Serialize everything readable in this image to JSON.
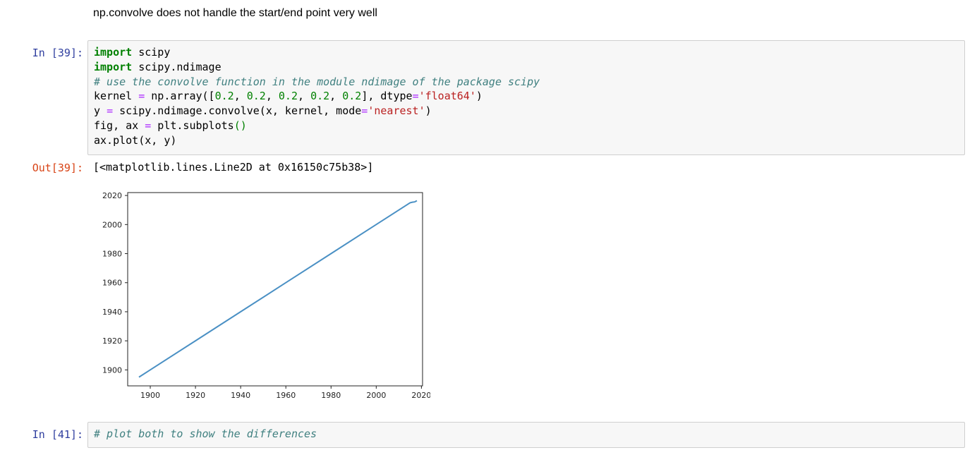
{
  "markdown": {
    "text": "np.convolve does not handle the start/end point very well"
  },
  "cell39": {
    "prompt_in": "In [39]:",
    "prompt_out": "Out[39]:",
    "lines": [
      [
        {
          "t": "import",
          "c": "kw"
        },
        {
          "t": " scipy",
          "c": ""
        }
      ],
      [
        {
          "t": "import",
          "c": "kw"
        },
        {
          "t": " scipy.ndimage",
          "c": ""
        }
      ],
      [
        {
          "t": "# use the convolve function in the module ndimage of the package scipy",
          "c": "cm"
        }
      ],
      [
        {
          "t": "kernel ",
          "c": ""
        },
        {
          "t": "=",
          "c": "op"
        },
        {
          "t": " np.array([",
          "c": ""
        },
        {
          "t": "0.2",
          "c": "nm"
        },
        {
          "t": ", ",
          "c": ""
        },
        {
          "t": "0.2",
          "c": "nm"
        },
        {
          "t": ", ",
          "c": ""
        },
        {
          "t": "0.2",
          "c": "nm"
        },
        {
          "t": ", ",
          "c": ""
        },
        {
          "t": "0.2",
          "c": "nm"
        },
        {
          "t": ", ",
          "c": ""
        },
        {
          "t": "0.2",
          "c": "nm"
        },
        {
          "t": "], dtype",
          "c": ""
        },
        {
          "t": "=",
          "c": "op"
        },
        {
          "t": "'float64'",
          "c": "st"
        },
        {
          "t": ")",
          "c": ""
        }
      ],
      [
        {
          "t": "y ",
          "c": ""
        },
        {
          "t": "=",
          "c": "op"
        },
        {
          "t": " scipy.ndimage.convolve(x, kernel, mode",
          "c": ""
        },
        {
          "t": "=",
          "c": "op"
        },
        {
          "t": "'nearest'",
          "c": "st"
        },
        {
          "t": ")",
          "c": ""
        }
      ],
      [
        {
          "t": "fig, ax ",
          "c": ""
        },
        {
          "t": "=",
          "c": "op"
        },
        {
          "t": " plt.subplots",
          "c": ""
        },
        {
          "t": "()",
          "c": "pn"
        }
      ],
      [
        {
          "t": "ax.plot(x, y)",
          "c": ""
        }
      ]
    ],
    "output_text": "[<matplotlib.lines.Line2D at 0x16150c75b38>]"
  },
  "cell41": {
    "prompt_in": "In [41]:",
    "lines": [
      [
        {
          "t": "# plot both to show the differences",
          "c": "cm"
        }
      ]
    ]
  },
  "colors": {
    "line": "#4a90c4",
    "prompt_in": "#303f9f",
    "prompt_out": "#d84315"
  },
  "chart_data": {
    "type": "line",
    "xlim": [
      1890,
      2020.5
    ],
    "ylim": [
      1889,
      2022
    ],
    "x_ticks": [
      1900,
      1920,
      1940,
      1960,
      1980,
      2000,
      2020
    ],
    "y_ticks": [
      1900,
      1920,
      1940,
      1960,
      1980,
      2000,
      2020
    ],
    "x_tick_labels": [
      "1900",
      "1920",
      "1940",
      "1960",
      "1980",
      "2000",
      "2020"
    ],
    "y_tick_labels": [
      "1900",
      "1920",
      "1940",
      "1960",
      "1980",
      "2000",
      "2020"
    ],
    "grid": false,
    "series": [
      {
        "x": [
          1895,
          1900,
          1920,
          1940,
          1960,
          1980,
          2000,
          2015,
          2016,
          2017,
          2018
        ],
        "y": [
          1895,
          1900,
          1920,
          1940,
          1960,
          1980,
          2000,
          2015,
          2015.4,
          2015.6,
          2016.4
        ]
      }
    ]
  }
}
